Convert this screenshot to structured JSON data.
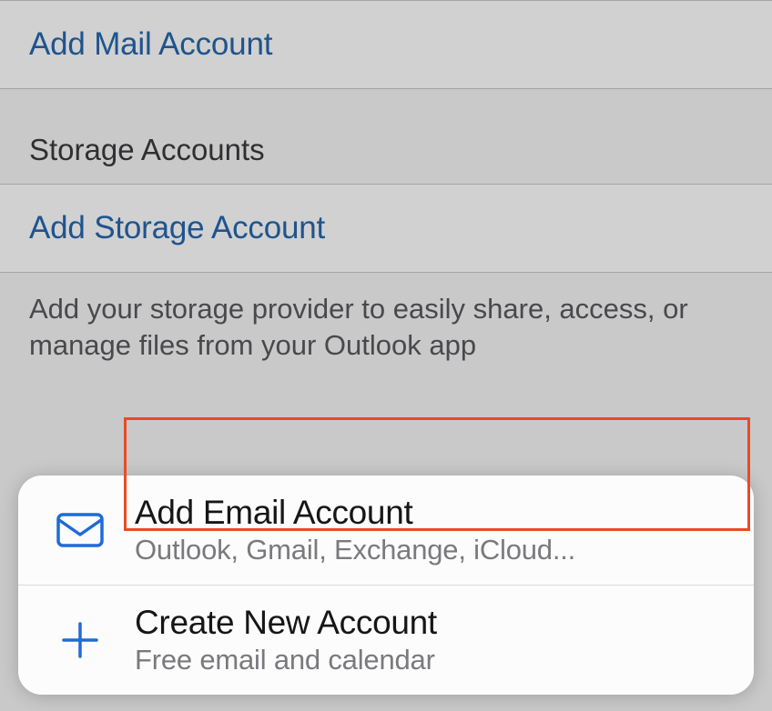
{
  "background": {
    "add_mail_label": "Add Mail Account",
    "storage_section_header": "Storage Accounts",
    "add_storage_label": "Add Storage Account",
    "storage_footer": "Add your storage provider to easily share, access, or manage files from your Outlook app"
  },
  "sheet": {
    "add_email": {
      "title": "Add Email Account",
      "subtitle": "Outlook, Gmail, Exchange, iCloud..."
    },
    "create_new": {
      "title": "Create New Account",
      "subtitle": "Free email and calendar"
    }
  },
  "colors": {
    "accent_blue": "#1f6bd8",
    "highlight_red": "#e84b26"
  }
}
